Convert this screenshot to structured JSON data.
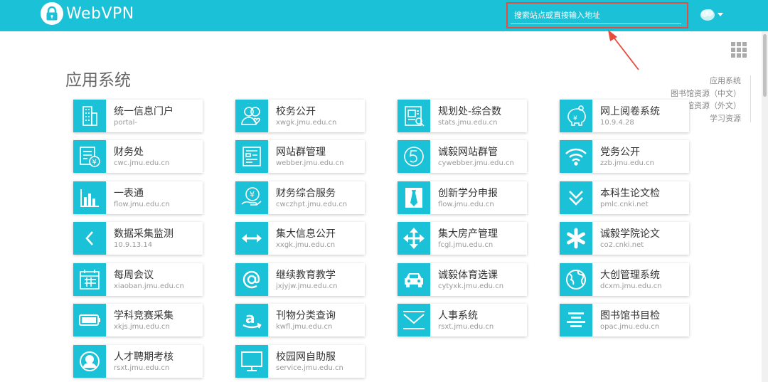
{
  "header": {
    "logo_text": "WebVPN",
    "search_placeholder": "搜索站点或直接输入地址",
    "accent_color": "#1bc1d6",
    "highlight_color": "#e74c3c"
  },
  "section_title": "应用系统",
  "side_nav": [
    "应用系统",
    "图书馆资源（中文）",
    "图书馆资源（外文）",
    "学习资源"
  ],
  "apps": [
    {
      "name": "统一信息门户",
      "url": "portal-",
      "icon": "building-icon"
    },
    {
      "name": "校务公开",
      "url": "xwgk.jmu.edu.cn",
      "icon": "people-icon"
    },
    {
      "name": "规划处-综合数",
      "url": "stats.jmu.edu.cn",
      "icon": "report-icon"
    },
    {
      "name": "网上阅卷系统",
      "url": "10.9.4.28",
      "icon": "piggy-bank-icon"
    },
    {
      "name": "财务处",
      "url": "cwc.jmu.edu.cn",
      "icon": "invoice-icon"
    },
    {
      "name": "网站群管理",
      "url": "webber.jmu.edu.cn",
      "icon": "form-icon"
    },
    {
      "name": "诚毅网站群管",
      "url": "cywebber.jmu.edu.cn",
      "icon": "number-five-icon"
    },
    {
      "name": "党务公开",
      "url": "zzb.jmu.edu.cn",
      "icon": "wifi-icon"
    },
    {
      "name": "一表通",
      "url": "flow.jmu.edu.cn",
      "icon": "bar-chart-icon"
    },
    {
      "name": "财务综合服务",
      "url": "cwczhpt.jmu.edu.cn",
      "icon": "yen-hand-icon"
    },
    {
      "name": "创新学分申报",
      "url": "flow.jmu.edu.cn",
      "icon": "tie-icon"
    },
    {
      "name": "本科生论文检",
      "url": "pmlc.cnki.net",
      "icon": "double-chevron-down-icon"
    },
    {
      "name": "数据采集监测",
      "url": "10.9.13.14",
      "icon": "chevron-left-icon"
    },
    {
      "name": "集大信息公开",
      "url": "xxgk.jmu.edu.cn",
      "icon": "horizontal-arrows-icon"
    },
    {
      "name": "集大房产管理",
      "url": "fcgl.jmu.edu.cn",
      "icon": "move-arrows-icon"
    },
    {
      "name": "诚毅学院论文",
      "url": "co2.cnki.net",
      "icon": "asterisk-icon"
    },
    {
      "name": "每周会议",
      "url": "xiaoban.jmu.edu.cn",
      "icon": "calendar-icon"
    },
    {
      "name": "继续教育教学",
      "url": "jxjyjw.jmu.edu.cn",
      "icon": "at-sign-icon"
    },
    {
      "name": "诚毅体育选课",
      "url": "cytyxk.jmu.edu.cn",
      "icon": "car-icon"
    },
    {
      "name": "大创管理系统",
      "url": "dcxm.jmu.edu.cn",
      "icon": "globe-icon"
    },
    {
      "name": "学科竞赛采集",
      "url": "xkjs.jmu.edu.cn",
      "icon": "battery-icon"
    },
    {
      "name": "刊物分类查询",
      "url": "kwfl.jmu.edu.cn",
      "icon": "amazon-icon"
    },
    {
      "name": "人事系统",
      "url": "rsxt.jmu.edu.cn",
      "icon": "envelope-icon"
    },
    {
      "name": "图书馆书目检",
      "url": "opac.jmu.edu.cn",
      "icon": "align-center-icon"
    },
    {
      "name": "人才聘期考核",
      "url": "rsxt.jmu.edu.cn",
      "icon": "user-circle-icon"
    },
    {
      "name": "校园网自助服",
      "url": "service.jmu.edu.cn",
      "icon": "monitor-icon"
    }
  ]
}
